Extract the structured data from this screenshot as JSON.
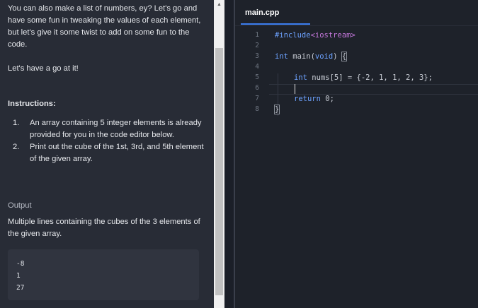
{
  "instructions": {
    "intro": "You can also make a list of numbers, ey? Let's go and have some fun in tweaking the values of each element, but let's give it some twist to add on some fun to the code.",
    "go": "Let's have a go at it!",
    "heading": "Instructions:",
    "items": [
      {
        "num": "1.",
        "text": "An array containing 5 integer elements is already provided for you in the code editor below."
      },
      {
        "num": "2.",
        "text": "Print out the cube of the 1st, 3rd, and 5th element of the given array."
      }
    ],
    "output_heading": "Output",
    "output_desc": "Multiple lines containing the cubes of the 3 elements of the given array.",
    "output_lines": [
      "-8",
      "1",
      "27"
    ]
  },
  "scrollbar": {
    "up_arrow": "▲"
  },
  "editor": {
    "tab": "main.cpp",
    "lines": [
      {
        "n": "1",
        "code": "#include<iostream>"
      },
      {
        "n": "2",
        "code": ""
      },
      {
        "n": "3",
        "code": "int main(void) {"
      },
      {
        "n": "4",
        "code": ""
      },
      {
        "n": "5",
        "code": "    int nums[5] = {-2, 1, 1, 2, 3};"
      },
      {
        "n": "6",
        "code": ""
      },
      {
        "n": "7",
        "code": "    return 0;"
      },
      {
        "n": "8",
        "code": "}"
      }
    ],
    "tokens": {
      "include": "#include",
      "header": "<iostream>",
      "int": "int",
      "main": " main(",
      "void": "void",
      "close_paren": ") ",
      "open_brace": "{",
      "decl": " nums[5] = {-2, 1, 1, 2, 3};",
      "return": "return",
      "zero": " 0;",
      "close_brace": "}"
    }
  }
}
